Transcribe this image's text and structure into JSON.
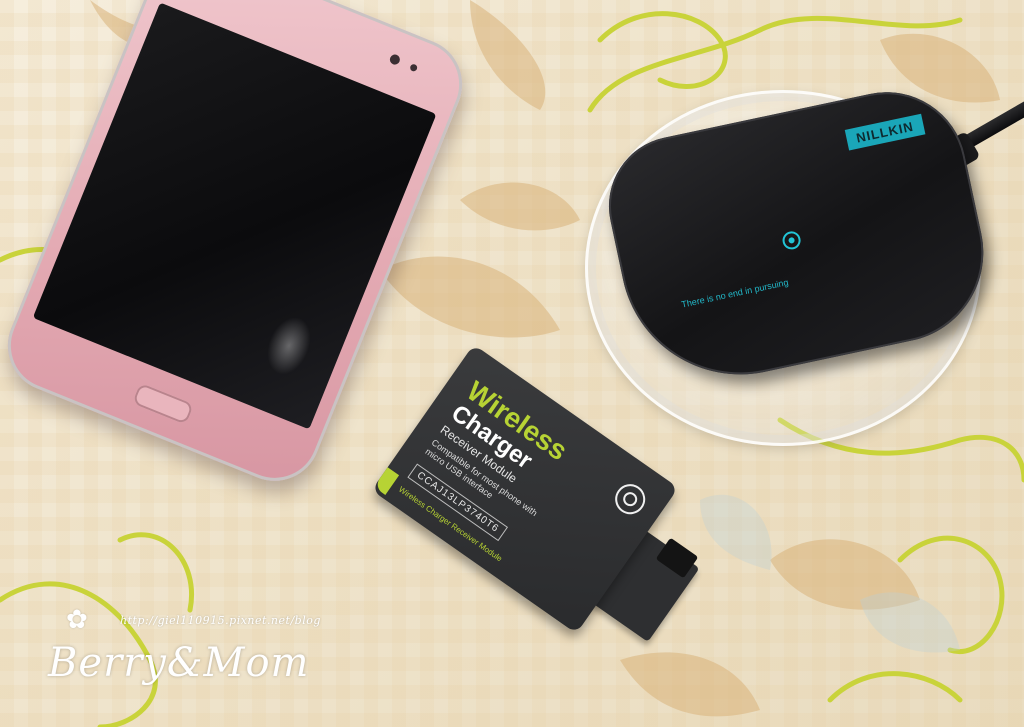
{
  "charging_pad": {
    "brand_logo": "NILLKIN",
    "slogan": "There is no end in pursuing",
    "led_color": "#22c4d6"
  },
  "receiver_card": {
    "title_line1": "Wireless",
    "title_line2": "Charger",
    "subtitle": "Receiver Module",
    "compatibility": "Compatible for most phone with micro USB interface",
    "serial": "CCAJ13LP3740T6",
    "footer": "Wireless Charger Receiver Module",
    "accent_color": "#b7d334"
  },
  "phone": {
    "color": "#e3a9b2"
  },
  "watermark": {
    "url": "http://giel110915.pixnet.net/blog",
    "brand": "Berry&Mom"
  }
}
